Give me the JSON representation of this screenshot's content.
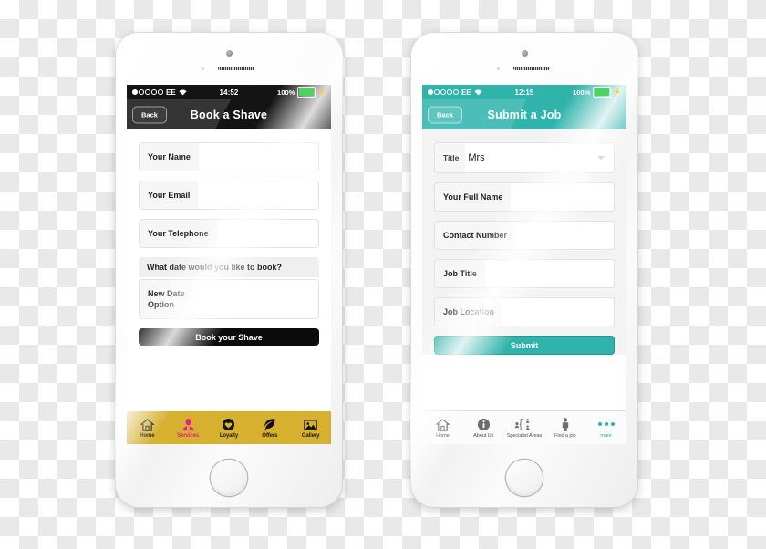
{
  "phones": [
    {
      "id": "left",
      "theme": "dark",
      "status": {
        "carrier": "EE",
        "signal_filled": 1,
        "signal_total": 5,
        "wifi_icon": "wifi-icon",
        "time": "14:52",
        "battery_percent": "100%",
        "battery_level": 100,
        "charging_icon": "lightning-bolt-icon"
      },
      "nav": {
        "back_label": "Back",
        "title": "Book a Shave"
      },
      "form": {
        "fields": [
          {
            "label": "Your Name",
            "value": ""
          },
          {
            "label": "Your Email",
            "value": ""
          },
          {
            "label": "Your Telephone",
            "value": ""
          }
        ],
        "section_title": "What date would you like to book?",
        "date_field": {
          "line1": "New Date",
          "line2": "Option",
          "value": ""
        },
        "submit_label": "Book your Shave"
      },
      "tabbar": {
        "style": "gold",
        "background": "#d6b02e",
        "active_color": "#e0218a",
        "tabs": [
          {
            "label": "Home",
            "icon": "home-icon",
            "active": false
          },
          {
            "label": "Services",
            "icon": "barber-person-icon",
            "active": true
          },
          {
            "label": "Loyalty",
            "icon": "heart-badge-icon",
            "active": false
          },
          {
            "label": "Offers",
            "icon": "leaf-icon",
            "active": false
          },
          {
            "label": "Gallery",
            "icon": "photos-icon",
            "active": false
          }
        ]
      }
    },
    {
      "id": "right",
      "theme": "teal",
      "accent": "#2fb3ab",
      "status": {
        "carrier": "EE",
        "signal_filled": 1,
        "signal_total": 5,
        "wifi_icon": "wifi-icon",
        "time": "12:15",
        "battery_percent": "100%",
        "battery_level": 100,
        "charging_icon": "lightning-bolt-icon"
      },
      "nav": {
        "back_label": "Back",
        "title": "Submit a Job"
      },
      "form": {
        "title_field": {
          "label": "Title",
          "value": "Mrs",
          "icon": "chevron-down-icon"
        },
        "fields": [
          {
            "label": "Your Full Name",
            "value": ""
          },
          {
            "label": "Contact Number",
            "value": ""
          },
          {
            "label": "Job Title",
            "value": ""
          },
          {
            "label": "Job Location",
            "value": ""
          }
        ],
        "submit_label": "Submit"
      },
      "tabbar": {
        "style": "light",
        "background": "#fbfbfb",
        "active_color": "#2fb3ab",
        "tabs": [
          {
            "label": "Home",
            "icon": "home-icon",
            "active": false
          },
          {
            "label": "About Us",
            "icon": "info-circle-icon",
            "active": false
          },
          {
            "label": "Specialist Areas",
            "icon": "people-group-icon",
            "active": false
          },
          {
            "label": "Find a job",
            "icon": "person-icon",
            "active": false
          },
          {
            "label": "more",
            "icon": "three-dots-icon",
            "active": true
          }
        ]
      }
    }
  ]
}
